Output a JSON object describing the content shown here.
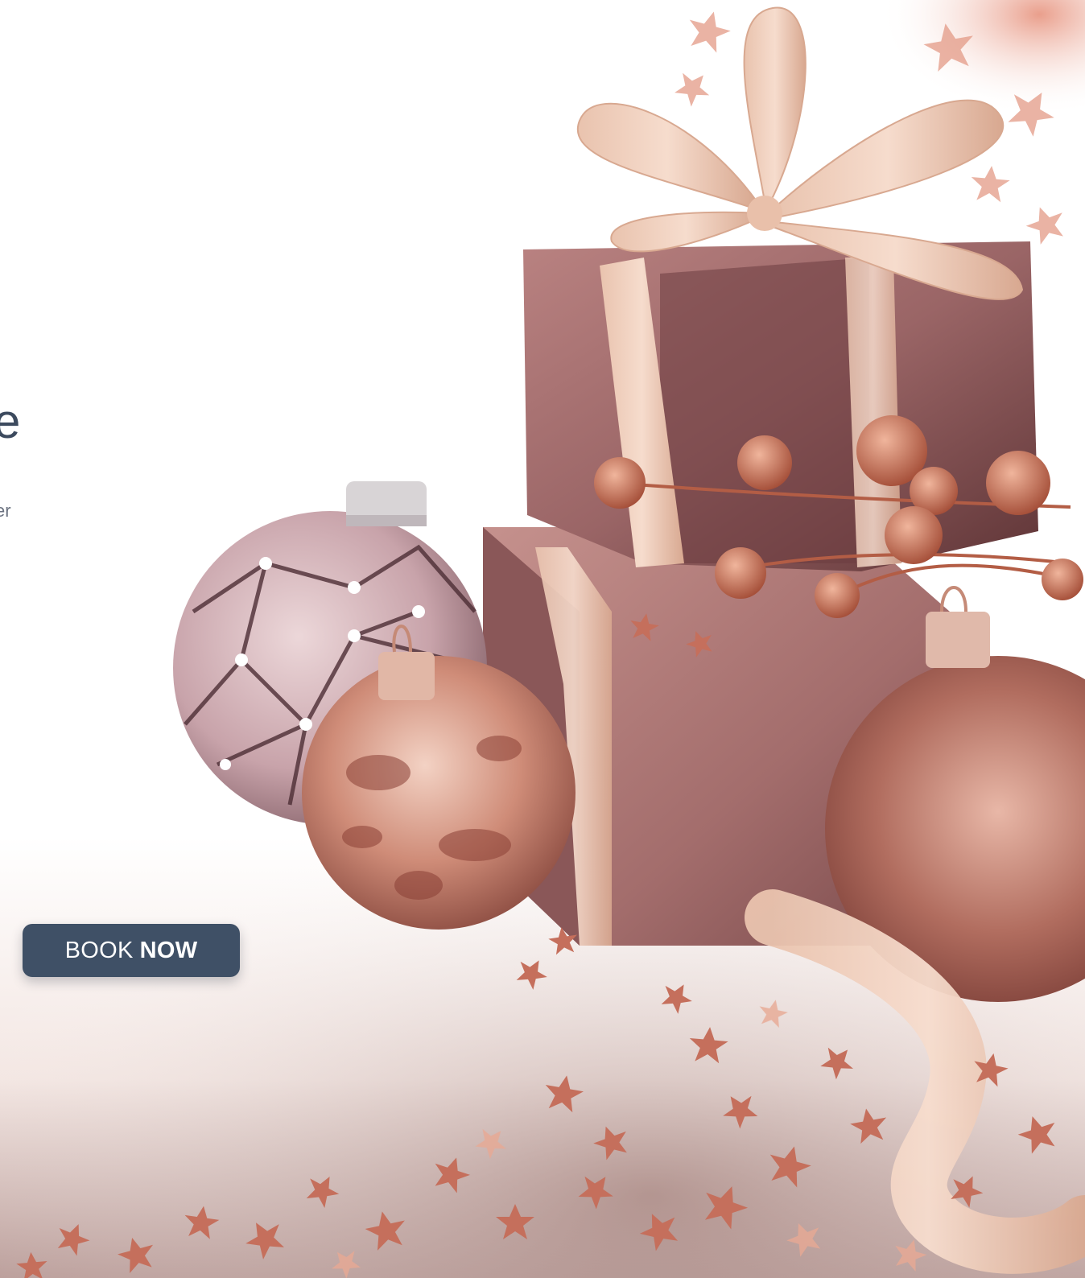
{
  "hero": {
    "headline_fragment": "e",
    "subtitle_fragment": "er"
  },
  "cta": {
    "label_light": "BOOK",
    "label_bold": "NOW"
  },
  "image": {
    "name": "christmas-gifts-baubles-photo",
    "colors": {
      "rose_gold": "#c98a76",
      "wrap_mauve": "#8e5a5c",
      "ribbon_champagne": "#ecc9b6",
      "button_navy": "#3f5066"
    }
  }
}
